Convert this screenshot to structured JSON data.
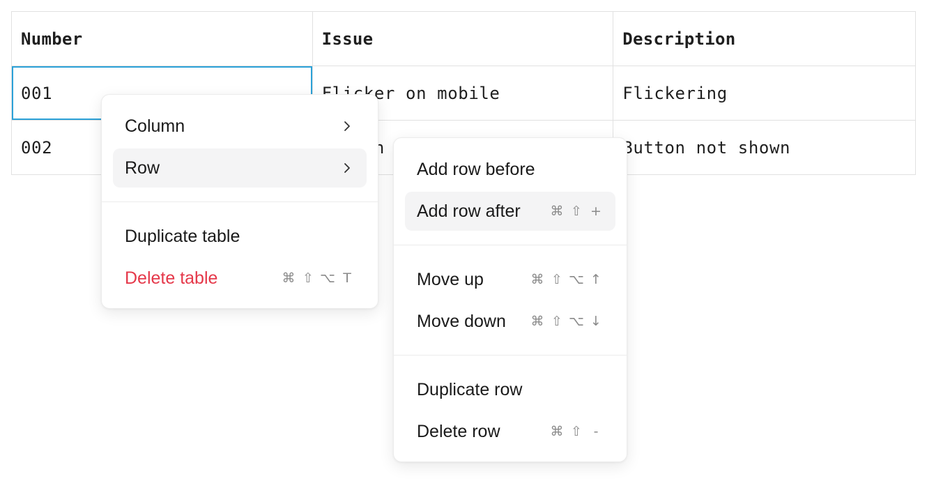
{
  "table": {
    "headers": [
      "Number",
      "Issue",
      "Description"
    ],
    "rows": [
      [
        "001",
        "Flicker on mobile",
        "Flickering"
      ],
      [
        "002",
        "Button hidden",
        "Button not shown"
      ]
    ]
  },
  "context_menu": {
    "items": [
      {
        "label": "Column",
        "submenu": true
      },
      {
        "label": "Row",
        "submenu": true
      },
      {
        "label": "Duplicate table"
      },
      {
        "label": "Delete table",
        "shortcut": [
          "⌘",
          "⇧",
          "⌥",
          "T"
        ]
      }
    ]
  },
  "row_submenu": {
    "items": [
      {
        "label": "Add row before"
      },
      {
        "label": "Add row after",
        "shortcut": [
          "⌘",
          "⇧",
          "+"
        ]
      },
      {
        "label": "Move up",
        "shortcut": [
          "⌘",
          "⇧",
          "⌥",
          "↑"
        ]
      },
      {
        "label": "Move down",
        "shortcut": [
          "⌘",
          "⇧",
          "⌥",
          "↓"
        ]
      },
      {
        "label": "Duplicate row"
      },
      {
        "label": "Delete row",
        "shortcut": [
          "⌘",
          "⇧",
          "-"
        ]
      }
    ]
  },
  "colors": {
    "selection_border": "#2ba1d8",
    "danger_text": "#e5384a",
    "active_item_bg": "#f4f4f5"
  },
  "icons": {
    "submenu_indicator": "chevron-right-icon"
  }
}
